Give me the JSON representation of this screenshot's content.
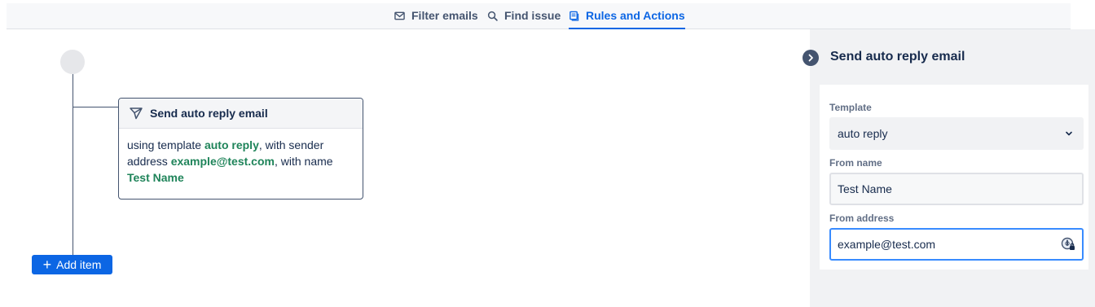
{
  "tabs": [
    {
      "label": "Filter emails",
      "icon": "mail-icon"
    },
    {
      "label": "Find issue",
      "icon": "search-icon"
    },
    {
      "label": "Rules and Actions",
      "icon": "rules-icon",
      "active": true
    }
  ],
  "flow": {
    "card": {
      "title": "Send auto reply email",
      "icon": "send-icon",
      "text_1": "using template ",
      "template": "auto reply",
      "text_2": ", with sender address ",
      "address": "example@test.com",
      "text_3": ", with name ",
      "name": "Test Name"
    },
    "add_item_label": "Add item"
  },
  "panel": {
    "title": "Send auto reply email",
    "template_label": "Template",
    "template_value": "auto reply",
    "from_name_label": "From name",
    "from_name_value": "Test Name",
    "from_address_label": "From address",
    "from_address_value": "example@test.com"
  },
  "colors": {
    "accent": "#0c66e4",
    "highlight": "#1f845a",
    "panel_bg": "#f1f2f4",
    "focus_border": "#388bff"
  }
}
